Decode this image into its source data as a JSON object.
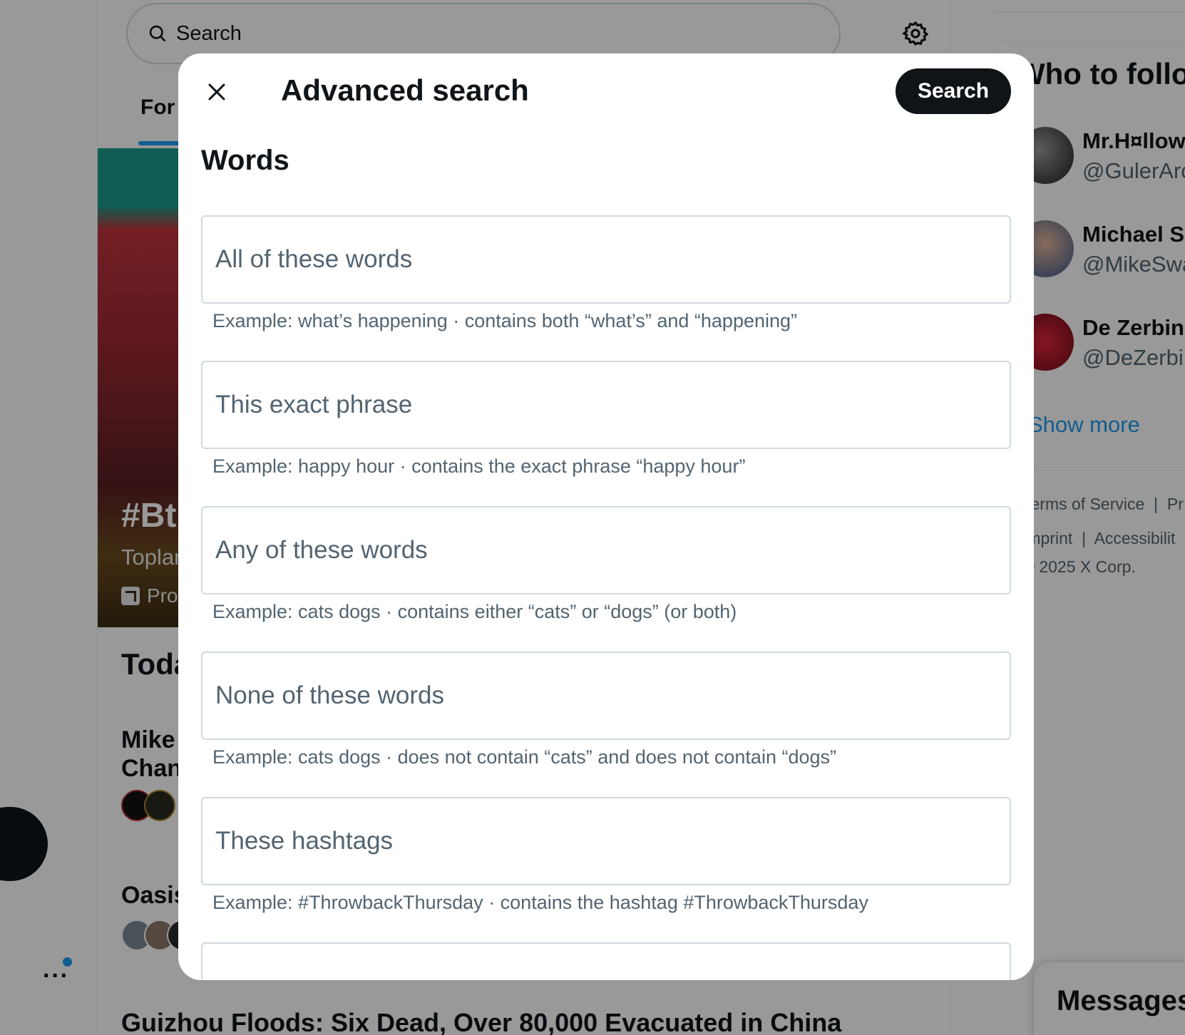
{
  "background": {
    "search": {
      "placeholder": "Search"
    },
    "tab_for": "For ",
    "hero": {
      "hashtag": "#Bt",
      "subtitle": "Toplar",
      "promoted": "Pro"
    },
    "today": "Toda",
    "trends": [
      {
        "title_line1": "Mike",
        "title_line2": "Chan"
      },
      {
        "title_line1": "Oasis"
      },
      {
        "title_line1": "Guizhou Floods: Six Dead, Over 80,000 Evacuated in China"
      }
    ],
    "more": "···"
  },
  "sidebar": {
    "who_to_follow_title": "Who to follo",
    "accounts": [
      {
        "name": "Mr.H¤llow",
        "handle": "@GulerArc"
      },
      {
        "name": "Michael S",
        "handle": "@MikeSwa"
      },
      {
        "name": "De Zerbin",
        "handle": "@DeZerbi"
      }
    ],
    "show_more": "Show more",
    "footer": {
      "line1_a": "Terms of Service",
      "sep": "|",
      "line1_b": "Pr",
      "line2_a": "Imprint",
      "line2_b": "Accessibilit",
      "copyright": "© 2025 X Corp."
    },
    "messages": "Messages"
  },
  "modal": {
    "title": "Advanced search",
    "search_button": "Search",
    "section_title": "Words",
    "fields": [
      {
        "placeholder": "All of these words",
        "hint": "Example: what’s happening · contains both “what’s” and “happening”"
      },
      {
        "placeholder": "This exact phrase",
        "hint": "Example: happy hour · contains the exact phrase “happy hour”"
      },
      {
        "placeholder": "Any of these words",
        "hint": "Example: cats dogs · contains either “cats” or “dogs” (or both)"
      },
      {
        "placeholder": "None of these words",
        "hint": "Example: cats dogs · does not contain “cats” and does not contain “dogs”"
      },
      {
        "placeholder": "These hashtags",
        "hint": "Example: #ThrowbackThursday · contains the hashtag #ThrowbackThursday"
      }
    ]
  },
  "colors": {
    "accent": "#1d9bf0",
    "text": "#0f1419",
    "muted": "#536471",
    "border": "#cfd9de"
  }
}
